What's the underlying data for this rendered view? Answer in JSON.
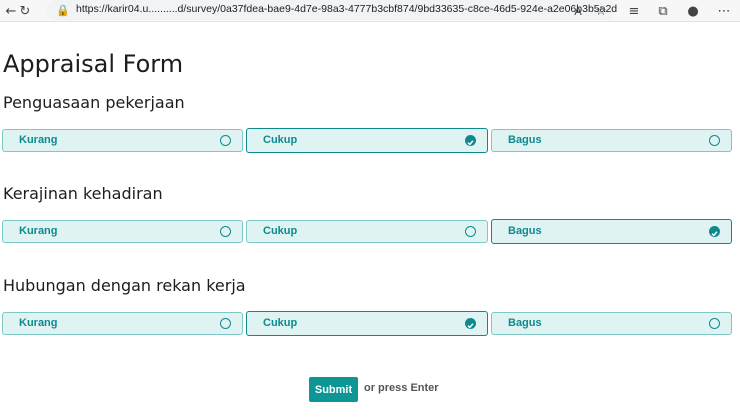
{
  "browser": {
    "url": "https://karir04.u..........d/survey/0a37fdea-bae9-4d7e-98a3-4777b3cbf874/9bd33635-c8ce-46d5-924e-a2e06b3b5a2d",
    "icons": [
      "back-icon",
      "reload-icon",
      "lock-icon",
      "read-aloud-icon",
      "favorite-add-icon",
      "favorites-icon",
      "collections-icon",
      "profile-icon",
      "more-icon"
    ]
  },
  "form": {
    "title": "Appraisal Form",
    "questions": [
      {
        "title": "Penguasaan pekerjaan",
        "options": [
          "Kurang",
          "Cukup",
          "Bagus"
        ],
        "selected": "Cukup"
      },
      {
        "title": "Kerajinan kehadiran",
        "options": [
          "Kurang",
          "Cukup",
          "Bagus"
        ],
        "selected": "Bagus"
      },
      {
        "title": "Hubungan dengan rekan kerja",
        "options": [
          "Kurang",
          "Cukup",
          "Bagus"
        ],
        "selected": "Cukup"
      }
    ],
    "submit_label": "Submit",
    "press_enter_label": "or press Enter"
  },
  "colors": {
    "accent": "#0e9696",
    "option_bg": "#e0f3f3",
    "option_text": "#0e8a8f"
  }
}
